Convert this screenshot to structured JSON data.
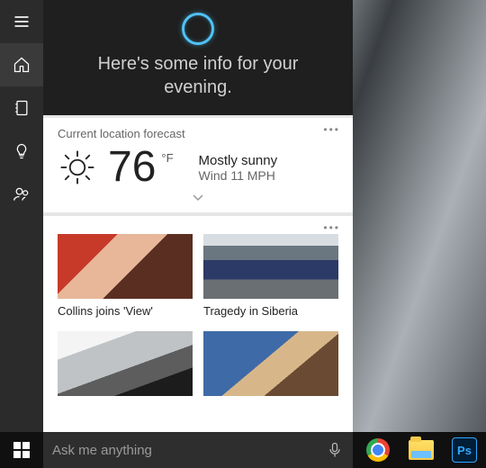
{
  "header": {
    "greeting": "Here's some info for your evening."
  },
  "rail": {
    "items": [
      {
        "name": "hamburger-icon"
      },
      {
        "name": "home-icon",
        "selected": true
      },
      {
        "name": "notebook-icon"
      },
      {
        "name": "lightbulb-icon"
      },
      {
        "name": "feedback-icon"
      }
    ]
  },
  "weather": {
    "label": "Current location forecast",
    "temp": "76",
    "unit": "°F",
    "condition": "Mostly sunny",
    "wind": "Wind 11 MPH"
  },
  "news": {
    "items": [
      {
        "title": "Collins joins 'View'"
      },
      {
        "title": "Tragedy in Siberia"
      },
      {
        "title": ""
      },
      {
        "title": ""
      }
    ]
  },
  "search": {
    "placeholder": "Ask me anything"
  },
  "taskbar": {
    "apps": [
      {
        "name": "chrome"
      },
      {
        "name": "file-explorer"
      },
      {
        "name": "photoshop",
        "label": "Ps"
      }
    ]
  }
}
